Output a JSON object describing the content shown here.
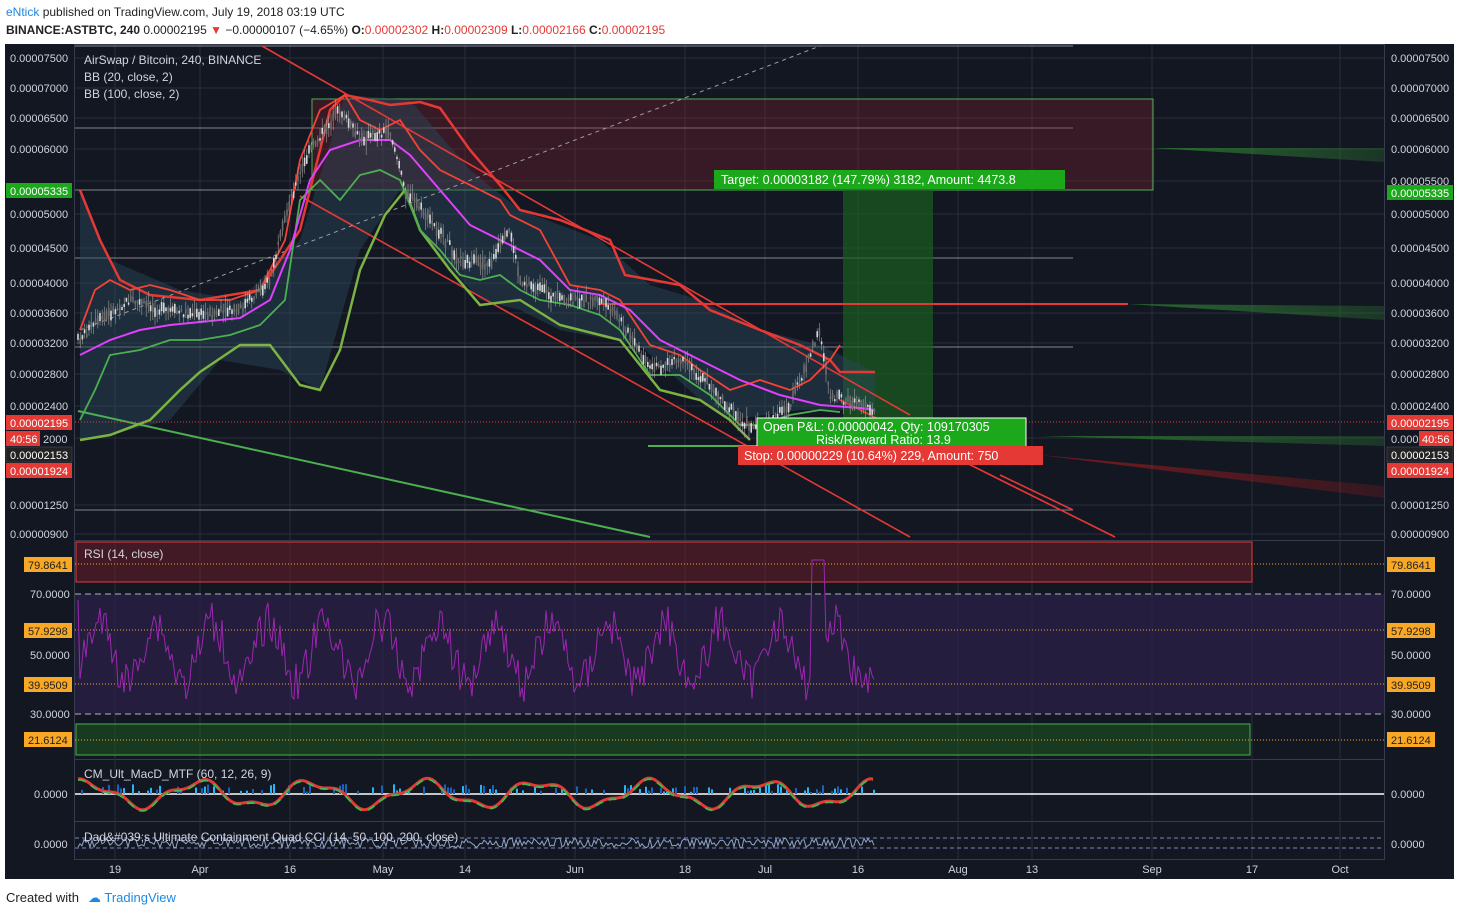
{
  "header": {
    "author": "eNtick",
    "published": "published on TradingView.com, July 19, 2018 03:19 UTC",
    "symbol": "BINANCE:ASTBTC, 240",
    "price": "0.00002195",
    "change": "−0.00000107 (−4.65%)",
    "o_label": "O:",
    "o": "0.00002302",
    "h_label": "H:",
    "h": "0.00002309",
    "l_label": "L:",
    "l": "0.00002166",
    "c_label": "C:",
    "c": "0.00002195"
  },
  "main_pane": {
    "legend": [
      "AirSwap / Bitcoin, 240, BINANCE",
      "BB (20, close, 2)",
      "BB (100, close, 2)"
    ],
    "y_ticks": [
      "0.00007500",
      "0.00007000",
      "0.00006500",
      "0.00006000",
      "0.00005500",
      "0.00005000",
      "0.00004500",
      "0.00004000",
      "0.00003600",
      "0.00003200",
      "0.00002800",
      "0.00002400",
      "0.00002000",
      "0.00001250",
      "0.00000900"
    ],
    "left_badges": {
      "target": "0.00005335",
      "price": "0.00002195",
      "timer": "40:56",
      "timer_tail": "2000",
      "sma": "0.00002153",
      "stop": "0.00001924"
    },
    "right_badges": {
      "target": "0.00005335",
      "price": "0.00002195",
      "timer_head": "0.000",
      "timer": "40:56",
      "sma": "0.00002153",
      "stop": "0.00001924"
    },
    "target_label": "Target: 0.00003182 (147.79%) 3182, Amount: 4473.8",
    "open_pl_label": "Open P&L: 0.00000042, Qty: 109170305",
    "rr_label": "Risk/Reward Ratio: 13.9",
    "stop_label": "Stop: 0.00000229 (10.64%) 229, Amount: 750",
    "colors": {
      "bg": "#131722",
      "price_badge": "#e53935",
      "target_badge": "#1ba81b",
      "sma_badge": "#222222",
      "bb20_mid": "#e040fb",
      "bb20_band": "#f44336",
      "bb100_band": "#7cb342"
    }
  },
  "rsi_pane": {
    "legend": "RSI (14, close)",
    "ticks": [
      "70.0000",
      "50.0000",
      "30.0000"
    ],
    "badges": [
      "79.8641",
      "57.9298",
      "39.9509",
      "21.6124"
    ]
  },
  "macd_pane": {
    "legend": "CM_Ult_MacD_MTF (60, 12, 26, 9)",
    "tick": "0.0000"
  },
  "cci_pane": {
    "legend": "Dad&#039;s Ultimate Containment Quad CCI (14, 50, 100, 200, close)",
    "tick": "0.0000"
  },
  "x_axis": [
    "19",
    "Apr",
    "16",
    "May",
    "14",
    "Jun",
    "18",
    "Jul",
    "16",
    "Aug",
    "13",
    "Sep",
    "17",
    "Oct"
  ],
  "footer": {
    "created": "Created with",
    "brand": "TradingView"
  }
}
